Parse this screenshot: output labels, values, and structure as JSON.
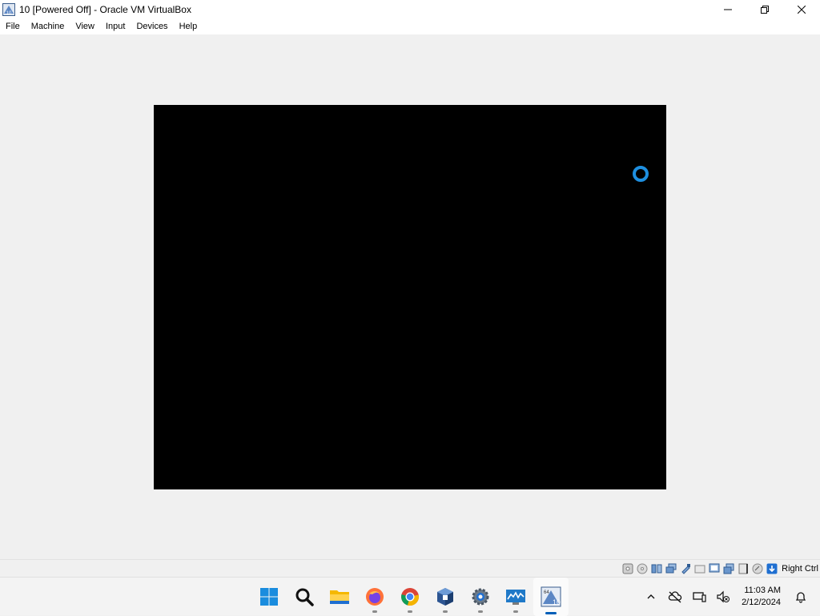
{
  "window": {
    "title": "10 [Powered Off] - Oracle VM VirtualBox",
    "icon": "virtualbox-vm-icon",
    "controls": [
      "minimize-icon",
      "maximize-icon",
      "close-icon"
    ]
  },
  "menu": {
    "items": [
      {
        "label": "File"
      },
      {
        "label": "Machine"
      },
      {
        "label": "View"
      },
      {
        "label": "Input"
      },
      {
        "label": "Devices"
      },
      {
        "label": "Help"
      }
    ]
  },
  "vm_display": {
    "state": "Powered Off",
    "screen_color": "#000000",
    "spinner_color": "#1e8fe0"
  },
  "statusbar": {
    "icons": [
      "hard-disk-icon",
      "optical-drive-icon",
      "audio-icon",
      "network-icon",
      "usb-icon",
      "shared-folders-icon",
      "display-icon",
      "recording-icon",
      "cpu-icon",
      "mouse-integration-icon",
      "keyboard-capture-icon"
    ],
    "host_key": "Right Ctrl"
  },
  "taskbar": {
    "apps": [
      {
        "name": "start-button",
        "running": false
      },
      {
        "name": "search-button",
        "running": false
      },
      {
        "name": "file-explorer-app",
        "running": false
      },
      {
        "name": "firefox-app",
        "running": true
      },
      {
        "name": "chrome-app",
        "running": true
      },
      {
        "name": "virtualbox-manager-app",
        "running": true
      },
      {
        "name": "settings-app",
        "running": true
      },
      {
        "name": "monitor-app",
        "running": true
      },
      {
        "name": "vm-10-app",
        "running": true,
        "active": true
      }
    ],
    "tray": {
      "icons": [
        "show-hidden-icons-chevron",
        "onedrive-offline-icon",
        "network-icon",
        "volume-muted-icon"
      ],
      "time": "11:03 AM",
      "date": "2/12/2024",
      "notification_icon": "bell-icon"
    }
  },
  "colors": {
    "accent": "#005fb8",
    "window_bg": "#f0f0f0"
  }
}
